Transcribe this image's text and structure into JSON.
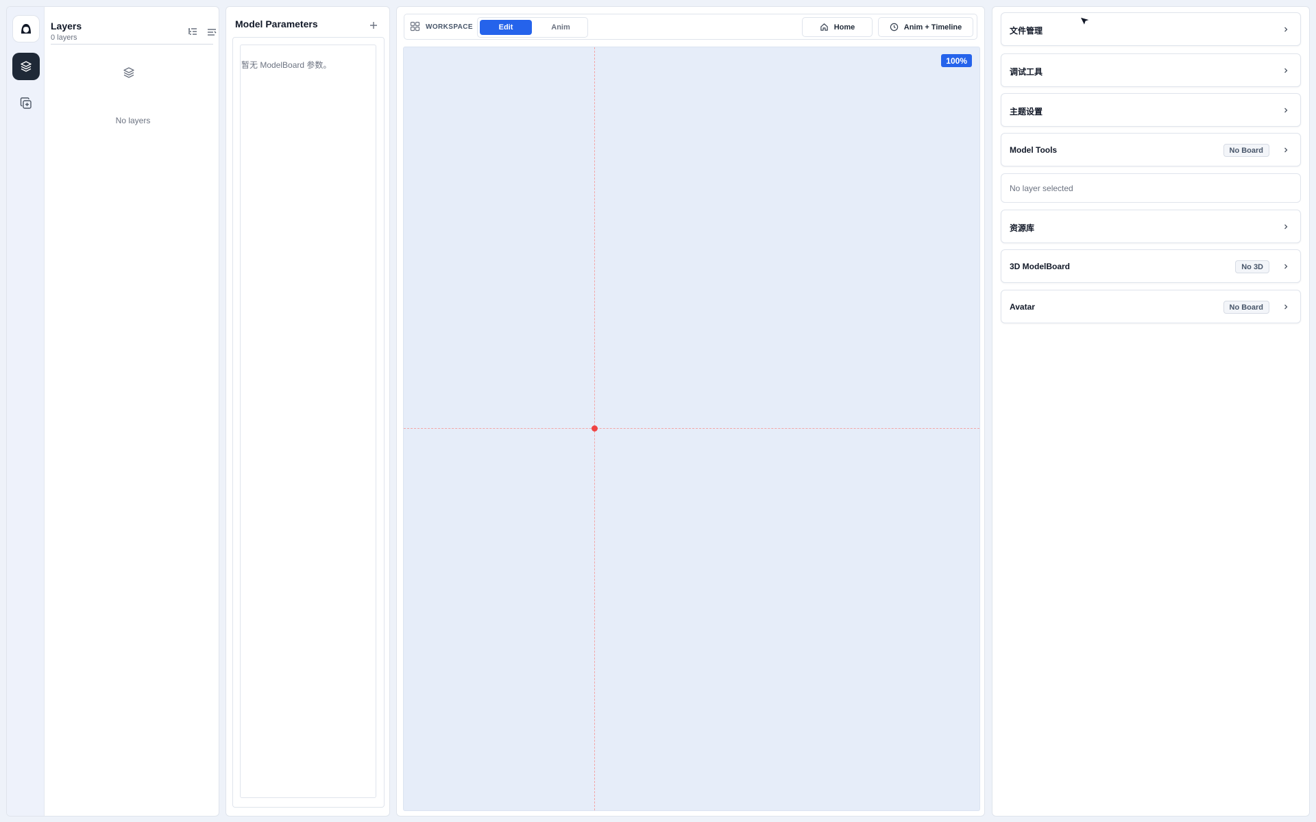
{
  "colors": {
    "accent": "#2563eb",
    "origin": "#ef4444",
    "canvas_bg": "#e6edf9"
  },
  "rail": {
    "items": [
      {
        "icon": "avatar-icon"
      },
      {
        "icon": "layers-icon",
        "active": true
      },
      {
        "icon": "add-copy-icon"
      }
    ]
  },
  "layers": {
    "title": "Layers",
    "count": "0 layers",
    "empty_text": "No layers"
  },
  "params": {
    "title": "Model Parameters",
    "empty_text": "暂无 ModelBoard 参数。"
  },
  "workspace": {
    "label": "WORKSPACE",
    "modes": [
      "Edit",
      "Anim"
    ],
    "active_mode": "Edit",
    "home_label": "Home",
    "anim_timeline_label": "Anim + Timeline",
    "zoom": "100%"
  },
  "tools": [
    "select-tool",
    "frame-tool",
    "rectangle-tool",
    "pen-tool"
  ],
  "right": {
    "sections": [
      {
        "label": "文件管理",
        "badge": ""
      },
      {
        "label": "调试工具",
        "badge": ""
      },
      {
        "label": "主题设置",
        "badge": ""
      },
      {
        "label": "Model Tools",
        "badge": "No Board"
      },
      {
        "label": "资源库",
        "badge": ""
      },
      {
        "label": "3D ModelBoard",
        "badge": "No 3D"
      },
      {
        "label": "Avatar",
        "badge": "No Board"
      }
    ],
    "no_layer_text": "No layer selected"
  }
}
